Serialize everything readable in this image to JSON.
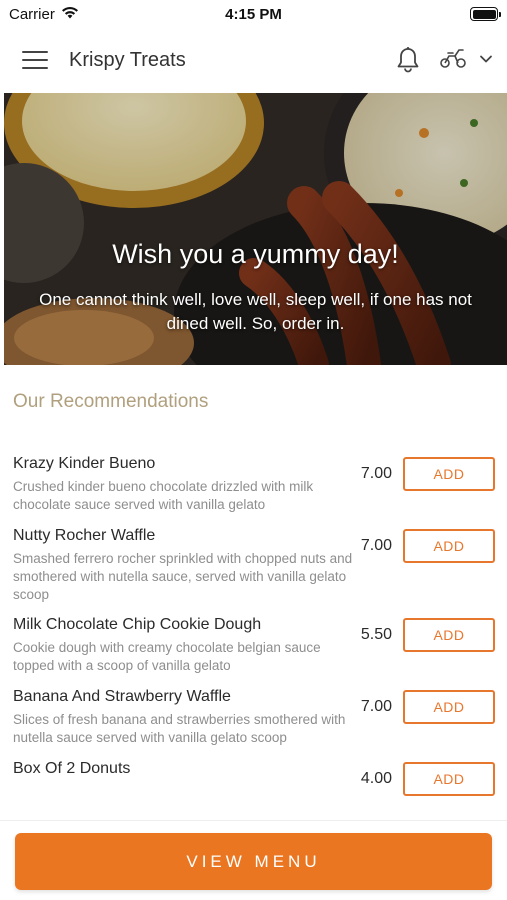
{
  "status_bar": {
    "carrier": "Carrier",
    "time": "4:15 PM"
  },
  "header": {
    "title": "Krispy Treats",
    "icons": [
      "menu-icon",
      "bell-icon",
      "scooter-icon",
      "chevron-down-icon"
    ]
  },
  "hero": {
    "title": "Wish you a yummy day!",
    "subtitle": "One cannot think well, love well, sleep well, if one has not dined well. So, order in."
  },
  "recommendations": {
    "title": "Our Recommendations",
    "items": [
      {
        "name": "Krazy Kinder Bueno",
        "description": "Crushed kinder bueno chocolate drizzled with milk chocolate sauce served with vanilla gelato",
        "price": "7.00",
        "add_label": "ADD"
      },
      {
        "name": "Nutty Rocher Waffle",
        "description": "Smashed ferrero rocher sprinkled with chopped nuts and smothered with nutella sauce, served with vanilla gelato scoop",
        "price": "7.00",
        "add_label": "ADD"
      },
      {
        "name": "Milk Chocolate Chip Cookie Dough",
        "description": "Cookie dough with creamy chocolate belgian sauce topped with a scoop of vanilla gelato",
        "price": "5.50",
        "add_label": "ADD"
      },
      {
        "name": "Banana And Strawberry Waffle",
        "description": "Slices of fresh banana and strawberries smothered with nutella sauce served with vanilla gelato scoop",
        "price": "7.00",
        "add_label": "ADD"
      },
      {
        "name": "Box Of 2 Donuts",
        "description": "",
        "price": "4.00",
        "add_label": "ADD"
      }
    ]
  },
  "footer": {
    "view_menu_label": "VIEW MENU"
  },
  "colors": {
    "accent": "#eb7621",
    "section_title": "#b1a07e",
    "description": "#8e8e8e"
  }
}
